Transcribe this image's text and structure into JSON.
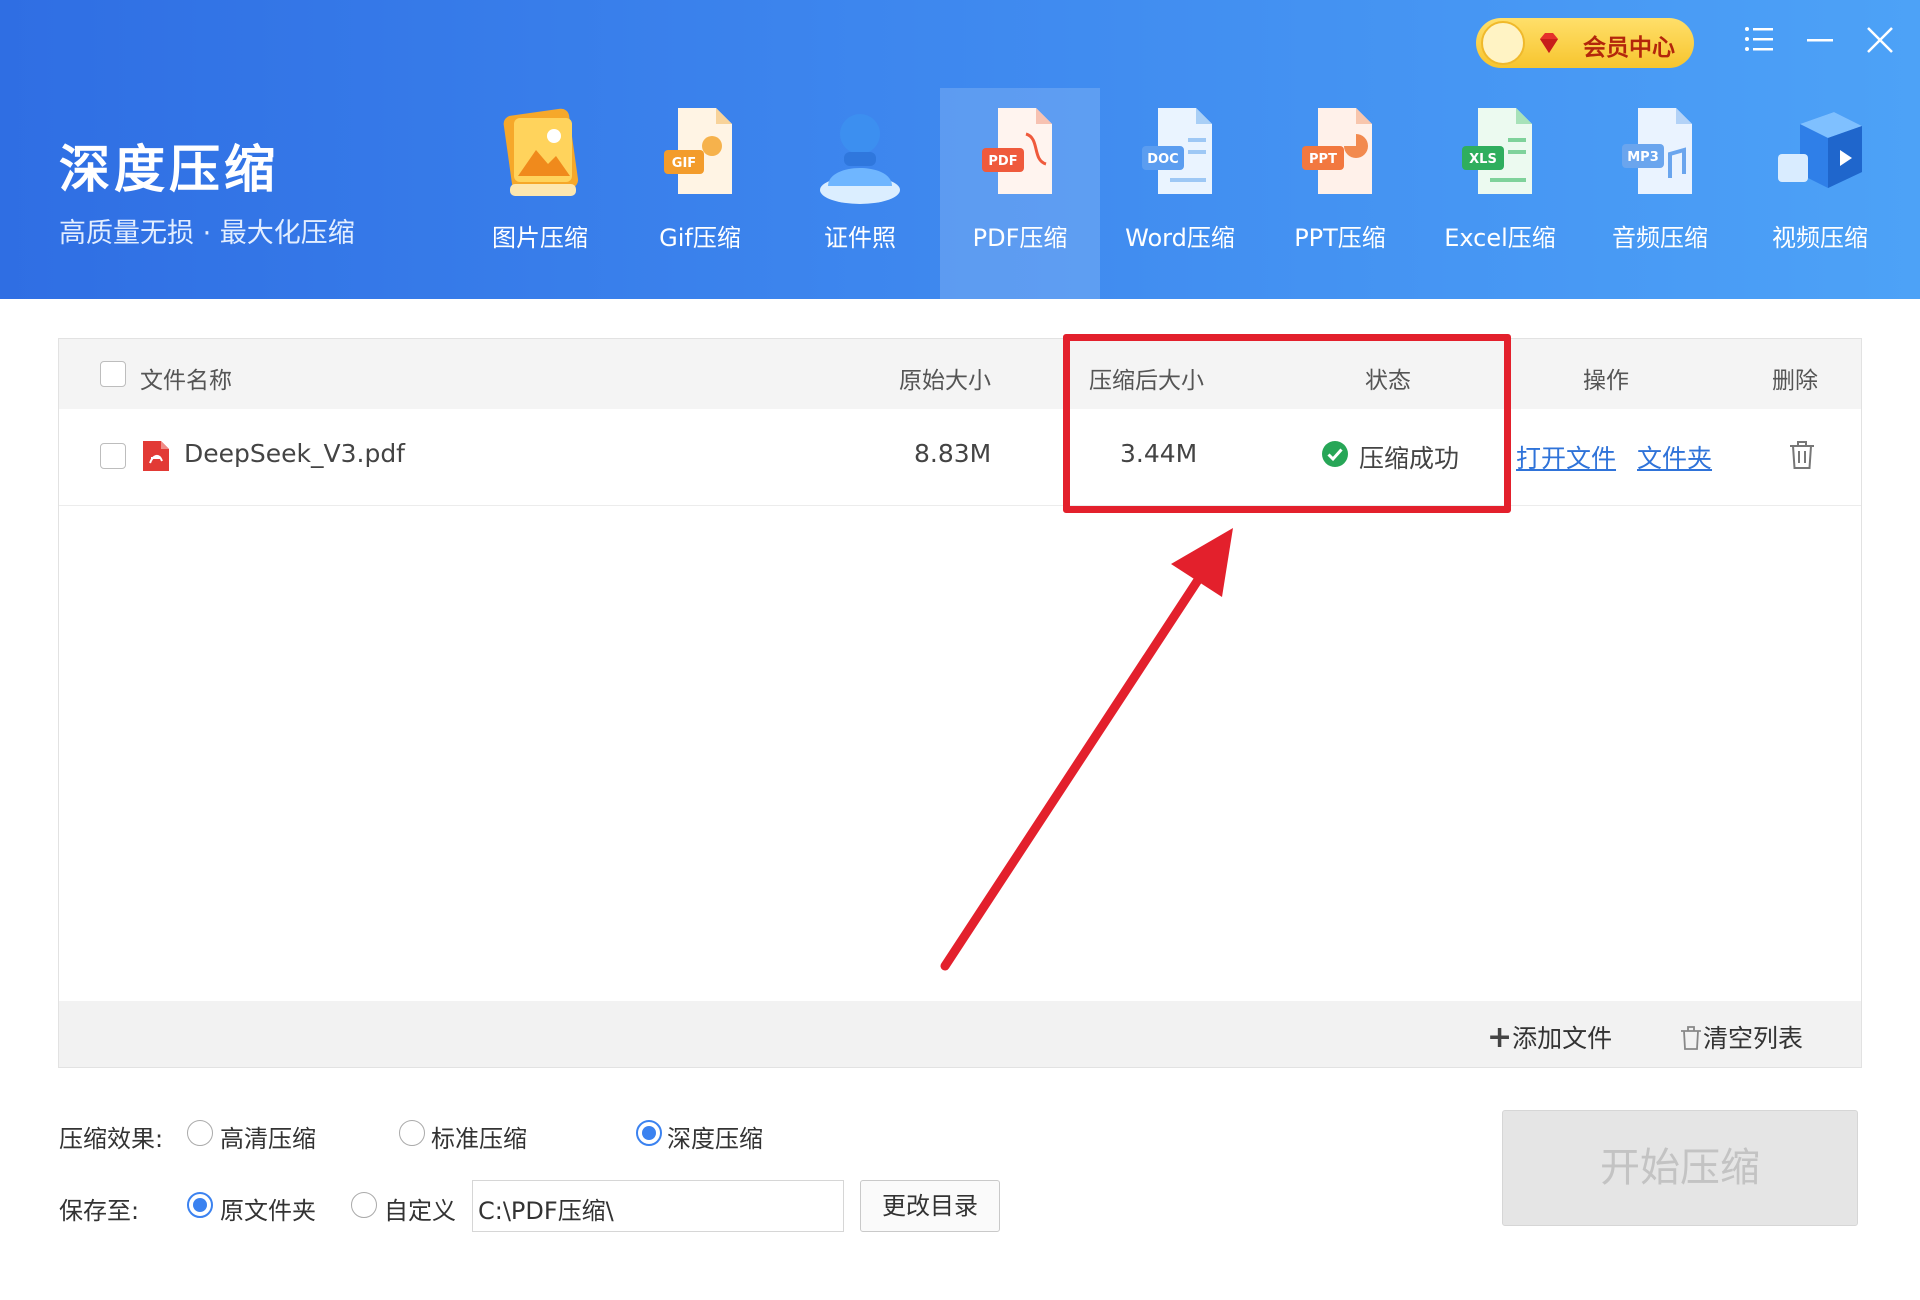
{
  "app": {
    "title": "深度压缩",
    "subtitle": "高质量无损 · 最大化压缩",
    "vip_label": "会员中心"
  },
  "toolbar": {
    "items": [
      {
        "label": "图片压缩",
        "icon": "image-compress-icon"
      },
      {
        "label": "Gif压缩",
        "icon": "gif-compress-icon"
      },
      {
        "label": "证件照",
        "icon": "id-photo-icon"
      },
      {
        "label": "PDF压缩",
        "icon": "pdf-compress-icon",
        "active": true
      },
      {
        "label": "Word压缩",
        "icon": "word-compress-icon"
      },
      {
        "label": "PPT压缩",
        "icon": "ppt-compress-icon"
      },
      {
        "label": "Excel压缩",
        "icon": "excel-compress-icon"
      },
      {
        "label": "音频压缩",
        "icon": "audio-compress-icon"
      },
      {
        "label": "视频压缩",
        "icon": "video-compress-icon"
      }
    ],
    "icon_badges": {
      "gif": "GIF",
      "pdf": "PDF",
      "doc": "DOC",
      "ppt": "PPT",
      "xls": "XLS",
      "mp3": "MP3"
    }
  },
  "table": {
    "headers": {
      "name": "文件名称",
      "original_size": "原始大小",
      "compressed_size": "压缩后大小",
      "status": "状态",
      "actions": "操作",
      "delete": "删除"
    },
    "rows": [
      {
        "name": "DeepSeek_V3.pdf",
        "original_size": "8.83M",
        "compressed_size": "3.44M",
        "status": "压缩成功",
        "open_file": "打开文件",
        "open_folder": "文件夹"
      }
    ],
    "footer": {
      "add_files": "添加文件",
      "clear_list": "清空列表"
    }
  },
  "options": {
    "effect_label": "压缩效果:",
    "effects": [
      "高清压缩",
      "标准压缩",
      "深度压缩"
    ],
    "selected_effect": "深度压缩",
    "save_label": "保存至:",
    "save_options": [
      "原文件夹",
      "自定义"
    ],
    "selected_save": "原文件夹",
    "path": "C:\\PDF压缩\\",
    "change_dir": "更改目录",
    "start": "开始压缩"
  },
  "colors": {
    "header_start": "#2f6ee3",
    "header_end": "#4da2f7",
    "link": "#2f73d9",
    "success": "#27a657",
    "annotation": "#e3202c"
  }
}
